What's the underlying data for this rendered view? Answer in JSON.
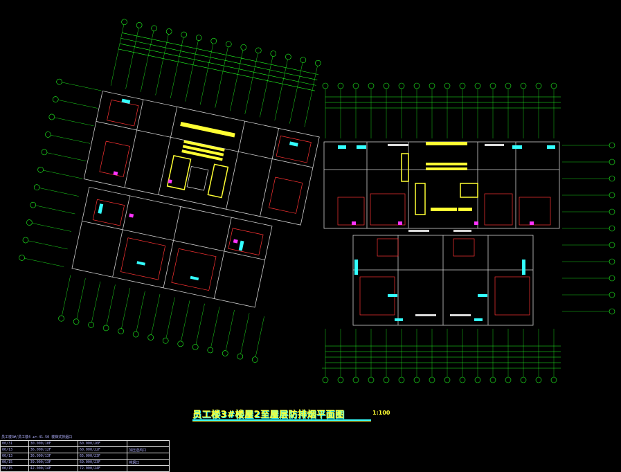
{
  "drawing": {
    "title": "员工楼3#楼屋2至屋层防排烟平面图",
    "scale": "1:100",
    "colors": {
      "background": "#000000",
      "axis_lines": "#22ff22",
      "walls": "#d0d0d0",
      "walls_accent": "#ff3333",
      "stairs": "#ffff33",
      "equipment": "#33ffff",
      "fan": "#ff33ff",
      "text": "#ffffff"
    }
  },
  "schedule": {
    "header": "员工楼3#/员工楼4 ±=-41.50     楼梯式排烟口",
    "rows": [
      {
        "c1": "00/31",
        "c2": "30.000/10F",
        "c3": "60.000/20F",
        "c4": ""
      },
      {
        "c1": "00/13",
        "c2": "36.000/12F",
        "c3": "60.000/22F",
        "c4": "加压送风口"
      },
      {
        "c1": "00/13",
        "c2": "36.000/13F",
        "c3": "65.000/23F",
        "c4": ""
      },
      {
        "c1": "00/15",
        "c2": "39.000/13F",
        "c3": "69.000/23F",
        "c4": "排烟口"
      },
      {
        "c1": "00/15",
        "c2": "42.000/14F",
        "c3": "72.000/24F",
        "c4": ""
      }
    ]
  },
  "icons": {
    "axis_bubble": "axis-bubble-icon",
    "fan": "fan-icon",
    "vent": "vent-icon",
    "stair": "stair-icon"
  }
}
